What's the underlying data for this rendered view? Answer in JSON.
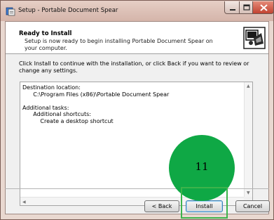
{
  "window": {
    "title": "Setup - Portable Document Spear",
    "controls": [
      "minimize-icon",
      "maximize-icon",
      "close-icon"
    ]
  },
  "header": {
    "title": "Ready to Install",
    "description": "Setup is now ready to begin installing Portable Document Spear on your computer.",
    "image_icon": "setup-wizard-icon"
  },
  "instruction": "Click Install to continue with the installation, or click Back if you want to review or change any settings.",
  "memo": {
    "lines": [
      "Destination location:",
      "      C:\\Program Files (x86)\\Portable Document Spear",
      "",
      "Additional tasks:",
      "      Additional shortcuts:",
      "          Create a desktop shortcut"
    ]
  },
  "buttons": {
    "back": "< Back",
    "install": "Install",
    "cancel": "Cancel"
  },
  "annotation": {
    "step_number": "11",
    "circle_color": "#0fa845",
    "box_color": "#3cb44b"
  }
}
